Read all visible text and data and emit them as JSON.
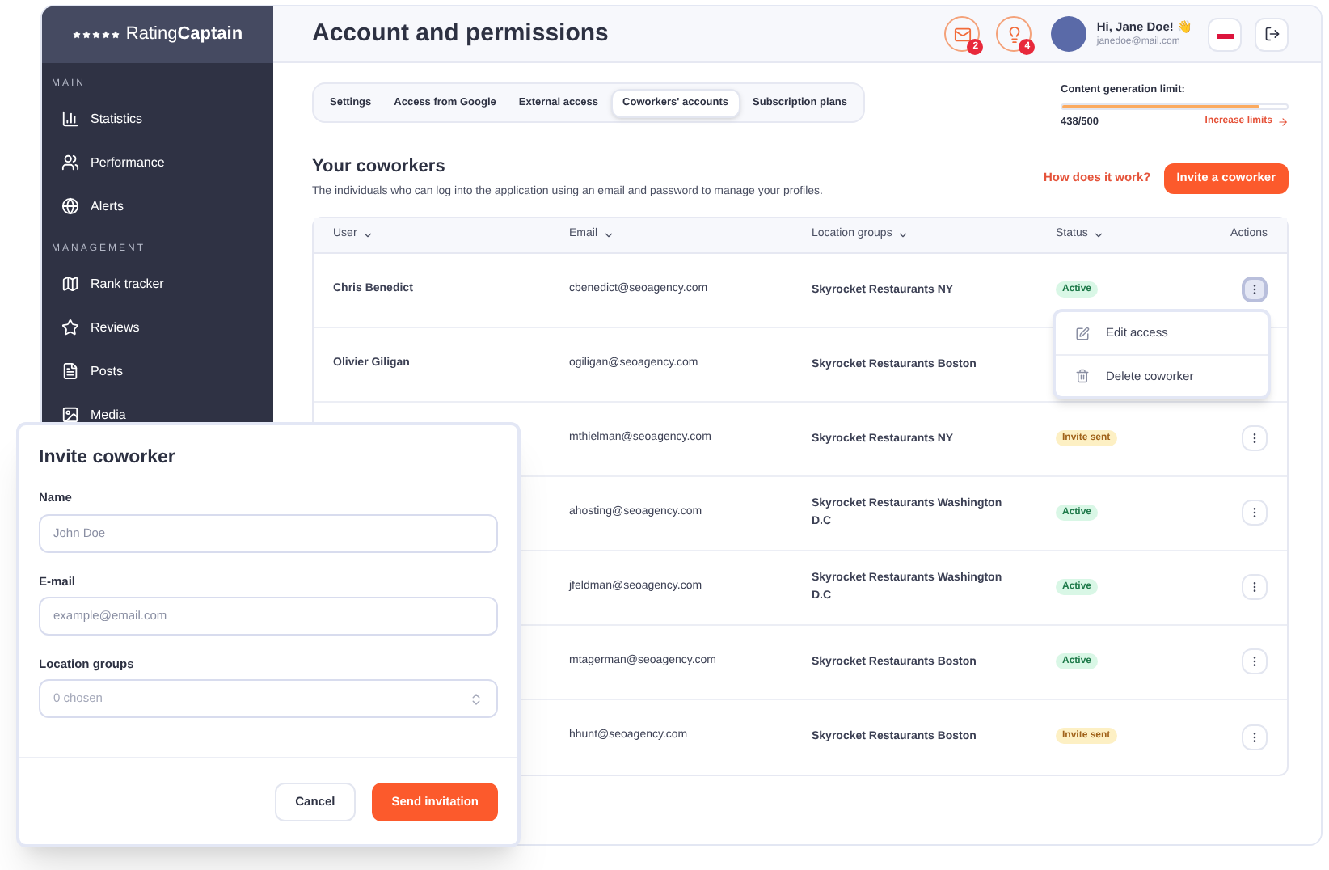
{
  "sidebar": {
    "logo": "Rating**Captain**",
    "sections": [
      {
        "title": "MAIN",
        "items": [
          {
            "label": "Statistics"
          },
          {
            "label": "Performance"
          },
          {
            "label": "Alerts"
          }
        ]
      },
      {
        "title": "MANAGEMENT",
        "items": [
          {
            "label": "Rank tracker"
          },
          {
            "label": "Reviews"
          },
          {
            "label": "Posts"
          },
          {
            "label": "Media"
          }
        ]
      }
    ]
  },
  "header": {
    "title": "Account and permissions",
    "mail_count": "2",
    "ideas_count": "4",
    "greeting": "Hi, Jane Doe! 👋",
    "email": "janedoe@mail.com"
  },
  "tabs": [
    {
      "label": "Settings",
      "selected": false
    },
    {
      "label": "Access from Google",
      "selected": false
    },
    {
      "label": "External access",
      "selected": false
    },
    {
      "label": "Coworkers' accounts",
      "selected": true
    },
    {
      "label": "Subscription plans",
      "selected": false
    }
  ],
  "limit": {
    "label": "Content generation limit:",
    "level": 0.876,
    "reading": "438/500",
    "link": "Increase limits"
  },
  "section": {
    "title": "Your coworkers",
    "description": "The individuals who can log into the application using an email and password to manage your profiles.",
    "help_link": "How does it work?",
    "invite_button": "Invite a coworker"
  },
  "table": {
    "columns": [
      "User",
      "Email",
      "Location groups",
      "Status",
      "Actions"
    ],
    "rows": [
      {
        "user": "Chris Benedict",
        "email": "cbenedict@seoagency.com",
        "location": "Skyrocket Restaurants NY",
        "status": "Active",
        "kind": "active",
        "menu_open": true
      },
      {
        "user": "Olivier Giligan",
        "email": "ogiligan@seoagency.com",
        "location": "Skyrocket Restaurants Boston",
        "menu_open": false
      },
      {
        "email": "mthielman@seoagency.com",
        "location": "Skyrocket Restaurants NY",
        "status": "Invite sent",
        "kind": "invite",
        "menu_open": false
      },
      {
        "email": "ahosting@seoagency.com",
        "location": "Skyrocket Restaurants Washington D.C",
        "status": "Active",
        "kind": "active",
        "menu_open": false
      },
      {
        "email": "jfeldman@seoagency.com",
        "location": "Skyrocket Restaurants Washington D.C",
        "status": "Active",
        "kind": "active",
        "menu_open": false
      },
      {
        "email": "mtagerman@seoagency.com",
        "location": "Skyrocket Restaurants Boston",
        "status": "Active",
        "kind": "active",
        "menu_open": false
      },
      {
        "email": "hhunt@seoagency.com",
        "location": "Skyrocket Restaurants Boston",
        "status": "Invite sent",
        "kind": "invite",
        "menu_open": false
      }
    ],
    "row_menu": [
      {
        "label": "Edit access"
      },
      {
        "label": "Delete coworker"
      }
    ]
  },
  "modal": {
    "title": "Invite coworker",
    "fields": [
      {
        "label": "Name",
        "placeholder": "John Doe",
        "kind": "text"
      },
      {
        "label": "E-mail",
        "placeholder": "example@email.com",
        "kind": "text"
      },
      {
        "label": "Location groups",
        "placeholder": "0 chosen",
        "kind": "select"
      }
    ],
    "cancel": "Cancel",
    "submit": "Send invitation"
  }
}
